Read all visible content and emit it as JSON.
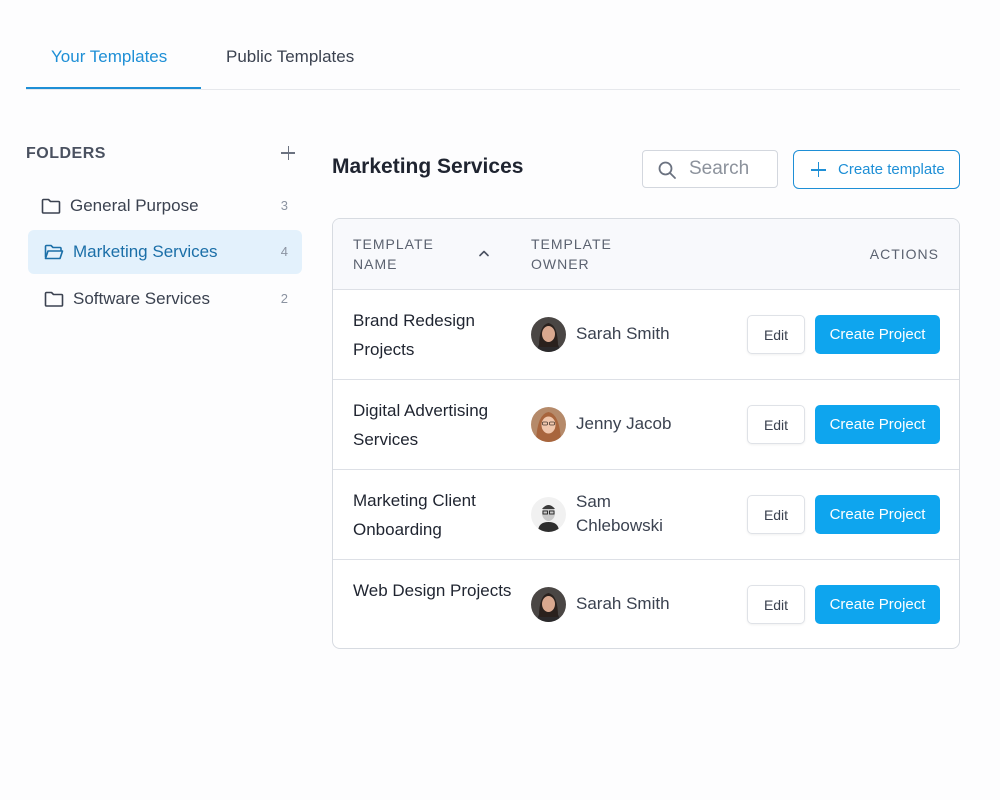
{
  "tabs": [
    {
      "label": "Your Templates",
      "active": true
    },
    {
      "label": "Public Templates",
      "active": false
    }
  ],
  "sidebar": {
    "title": "FOLDERS",
    "add_icon": "plus-icon",
    "items": [
      {
        "label": "General Purpose",
        "count": "3",
        "icon": "folder-icon",
        "active": false
      },
      {
        "label": "Marketing Services",
        "count": "4",
        "icon": "folder-open-icon",
        "active": true
      },
      {
        "label": "Software Services",
        "count": "2",
        "icon": "folder-icon",
        "active": false
      }
    ]
  },
  "main": {
    "title": "Marketing Services",
    "search": {
      "placeholder": "Search",
      "icon": "search-icon"
    },
    "create_template_label": "Create template"
  },
  "table": {
    "headers": {
      "name": "TEMPLATE NAME",
      "owner": "TEMPLATE OWNER",
      "actions": "ACTIONS"
    },
    "rows": [
      {
        "name": "Brand Redesign Projects",
        "owner": "Sarah Smith",
        "edit": "Edit",
        "create": "Create Project"
      },
      {
        "name": "Digital Advertising Services",
        "owner": "Jenny Jacob",
        "edit": "Edit",
        "create": "Create Project"
      },
      {
        "name": "Marketing Client Onboarding",
        "owner": "Sam Chlebowski",
        "edit": "Edit",
        "create": "Create Project"
      },
      {
        "name": "Web Design Projects",
        "owner": "Sarah Smith",
        "edit": "Edit",
        "create": "Create Project"
      }
    ]
  },
  "colors": {
    "accent": "#1e8fd6",
    "primary_button": "#0ea5ee",
    "active_folder_bg": "#e3f1fc"
  }
}
